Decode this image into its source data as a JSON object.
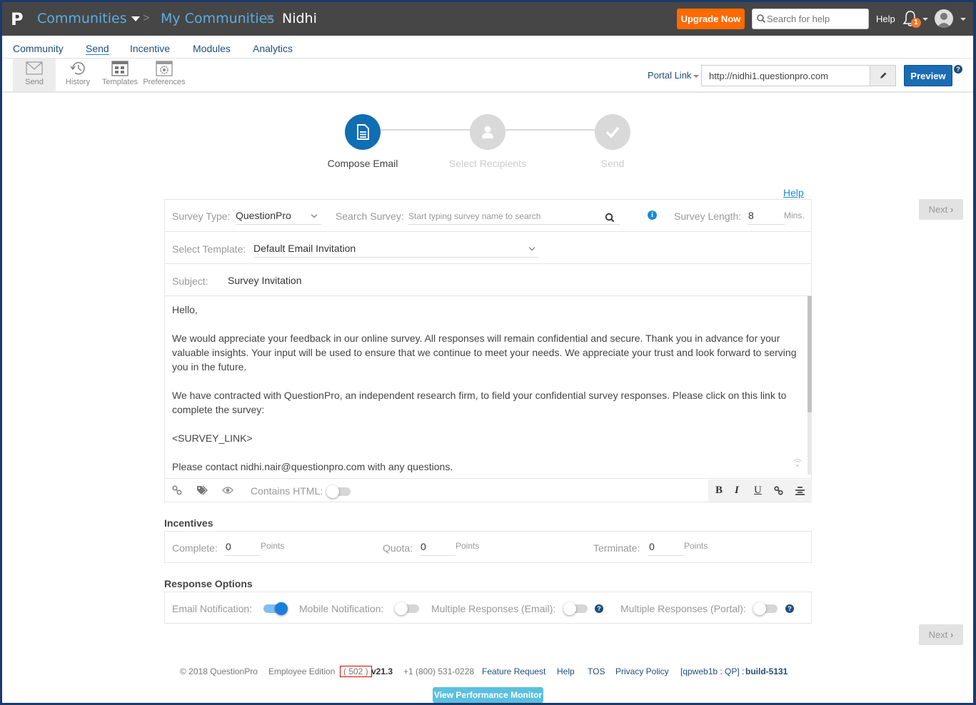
{
  "header": {
    "logo": "P",
    "breadcrumbs": [
      "Communities",
      "My Communities",
      "Nidhi"
    ],
    "upgrade_label": "Upgrade Now",
    "search_placeholder": "Search for help",
    "help_label": "Help",
    "notification_count": "1"
  },
  "nav": {
    "tabs": [
      "Community",
      "Send",
      "Incentive",
      "Modules",
      "Analytics"
    ],
    "active": "Send"
  },
  "toolbar": {
    "tools": [
      "Send",
      "History",
      "Templates",
      "Preferences"
    ],
    "portal_link_label": "Portal Link",
    "portal_url": "http://nidhi1.questionpro.com",
    "preview_label": "Preview"
  },
  "stepper": {
    "steps": [
      "Compose Email",
      "Select Recipients",
      "Send"
    ],
    "active_index": 0
  },
  "form": {
    "help_label": "Help",
    "next_label": "Next",
    "survey_type_label": "Survey Type:",
    "survey_type_value": "QuestionPro",
    "search_survey_label": "Search Survey:",
    "search_survey_placeholder": "Start typing survey name to search",
    "survey_length_label": "Survey Length:",
    "survey_length_value": "8",
    "survey_length_unit": "Mins.",
    "template_label": "Select Template:",
    "template_value": "Default Email Invitation",
    "subject_label": "Subject:",
    "subject_value": "Survey Invitation",
    "body": [
      "Hello,",
      "We would appreciate your feedback in our online survey.  All responses will remain confidential and secure.  Thank you in advance for your valuable insights.  Your input will be used to ensure that we continue to meet your needs. We appreciate your trust and look forward to serving you in the future.",
      "We have contracted with QuestionPro, an independent research firm, to field your confidential survey responses.  Please click on this link to complete the survey:",
      "<SURVEY_LINK>",
      "Please contact nidhi.nair@questionpro.com with any questions."
    ],
    "contains_html_label": "Contains HTML:",
    "contains_html_on": false,
    "format_buttons": [
      "B",
      "I",
      "U"
    ]
  },
  "incentives": {
    "title": "Incentives",
    "complete_label": "Complete:",
    "complete_value": "0",
    "quota_label": "Quota:",
    "quota_value": "0",
    "terminate_label": "Terminate:",
    "terminate_value": "0",
    "unit": "Points"
  },
  "response_options": {
    "title": "Response Options",
    "email_notification_label": "Email Notification:",
    "email_notification_on": true,
    "mobile_notification_label": "Mobile Notification:",
    "mobile_notification_on": false,
    "multi_email_label": "Multiple Responses (Email):",
    "multi_email_on": false,
    "multi_portal_label": "Multiple Responses (Portal):",
    "multi_portal_on": false
  },
  "footer": {
    "copyright": "© 2018 QuestionPro",
    "edition": "Employee Edition",
    "edition_code": "( 502 )",
    "version": "v21.3",
    "phone": "+1 (800) 531-0228",
    "links": [
      "Feature Request",
      "Help",
      "TOS",
      "Privacy Policy"
    ],
    "server": "[qpweb1b : QP] :",
    "build": "build-5131",
    "perf_button": "View Performance Monitor"
  }
}
